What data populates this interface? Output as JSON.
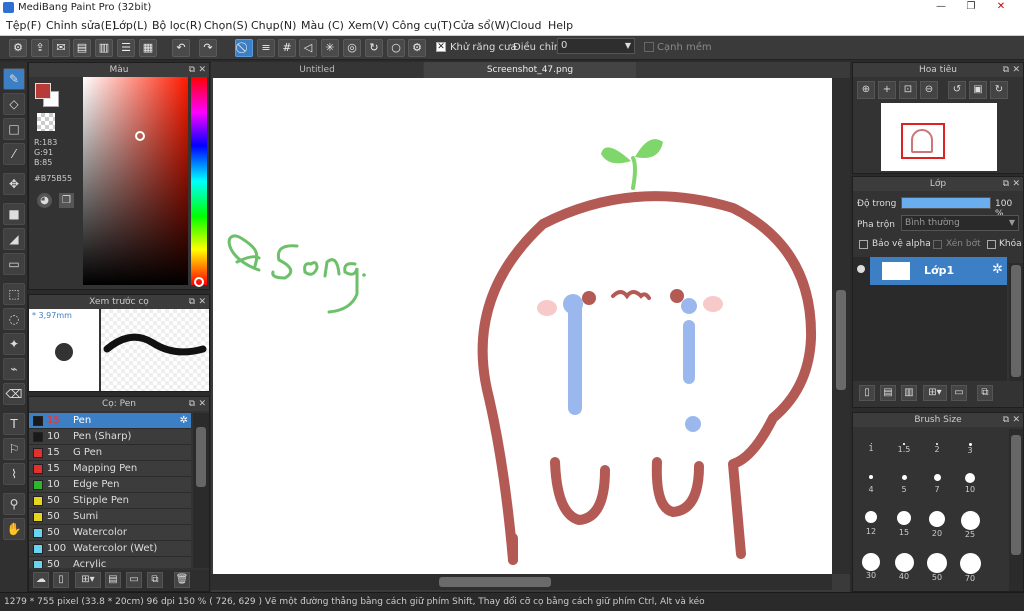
{
  "window": {
    "title": "MediBang Paint Pro (32bit)",
    "minimize": "—",
    "maximize": "❐",
    "close": "✕"
  },
  "menu": [
    "Tệp(F)",
    "Chỉnh sửa(E)",
    "Lớp(L)",
    "Bộ lọc(R)",
    "Chọn(S)",
    "Chụp(N)",
    "Màu (C)",
    "Xem(V)",
    "Công cụ(T)",
    "Cửa sổ(W)",
    "Cloud",
    "Help"
  ],
  "toolbar": {
    "antialias_label": "Khử răng cưa",
    "correction_label": "Điều chỉnh",
    "correction_value": "0",
    "soft_edge_label": "Cạnh mềm"
  },
  "color_panel": {
    "title": "Màu",
    "r": "R:183",
    "g": "G:91",
    "b": "B:85",
    "hex": "#B75B55",
    "fg_color": "#b73b37"
  },
  "brush_preview": {
    "title": "Xem trước cọ",
    "size": "* 3,97mm"
  },
  "brush_panel": {
    "title": "Cọ: Pen",
    "items": [
      {
        "size": "15",
        "name": "Pen",
        "color": "#1a1a1a"
      },
      {
        "size": "10",
        "name": "Pen (Sharp)",
        "color": "#1a1a1a"
      },
      {
        "size": "15",
        "name": "G Pen",
        "color": "#e53030"
      },
      {
        "size": "15",
        "name": "Mapping Pen",
        "color": "#e53030"
      },
      {
        "size": "10",
        "name": "Edge Pen",
        "color": "#2db52d"
      },
      {
        "size": "50",
        "name": "Stipple Pen",
        "color": "#e8d520"
      },
      {
        "size": "50",
        "name": "Sumi",
        "color": "#e8d520"
      },
      {
        "size": "50",
        "name": "Watercolor",
        "color": "#6ad3f0"
      },
      {
        "size": "100",
        "name": "Watercolor (Wet)",
        "color": "#6ad3f0"
      },
      {
        "size": "50",
        "name": "Acrylic",
        "color": "#6ad3f0"
      }
    ]
  },
  "tabs": [
    "Untitled",
    "Screenshot_47.png"
  ],
  "navigator": {
    "title": "Hoa tiêu"
  },
  "layer_panel": {
    "title": "Lớp",
    "opacity_label": "Độ trong",
    "opacity_value": "100 %",
    "opacity_level": 1.0,
    "blend_label": "Pha trộn",
    "blend_value": "Bình thường",
    "protect_alpha": "Bảo vệ alpha",
    "clipping": "Xén bớt",
    "lock": "Khóa",
    "layer_name": "Lớp1"
  },
  "brush_size_panel": {
    "title": "Brush Size",
    "sizes": [
      "1",
      "1.5",
      "2",
      "3",
      "4",
      "5",
      "7",
      "10",
      "12",
      "15",
      "20",
      "25",
      "30",
      "40",
      "50",
      "70"
    ]
  },
  "status": "1279 * 755 pixel   (33.8 * 20cm)   96 dpi   150 %   ( 726, 629 )   Vẽ một đường thẳng bằng cách giữ phím Shift, Thay đổi cỡ cọ bằng cách giữ phím Ctrl, Alt và kéo"
}
